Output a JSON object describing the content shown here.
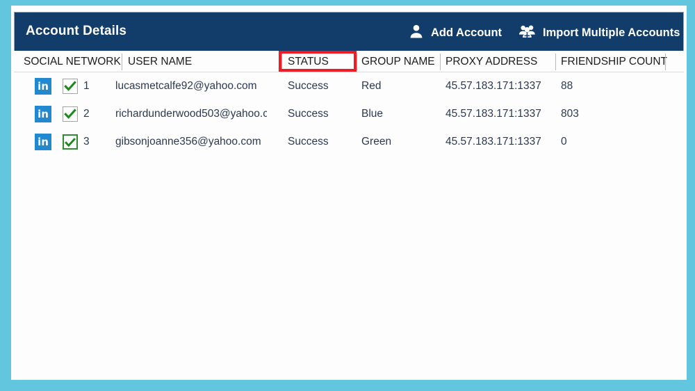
{
  "window": {
    "title": "Account Details",
    "frame_color": "#63c6df",
    "titlebar_color": "#123d6b",
    "body_color": "#fdfdfd"
  },
  "toolbar": {
    "actions": [
      {
        "label": "Add Account",
        "icon": "person-icon"
      },
      {
        "label": "Import Multiple Accounts",
        "icon": "people-group-icon"
      }
    ]
  },
  "table": {
    "columns": [
      {
        "key": "social_network",
        "label": "SOCIAL NETWORK"
      },
      {
        "key": "user_name",
        "label": "USER NAME"
      },
      {
        "key": "status",
        "label": "STATUS"
      },
      {
        "key": "group_name",
        "label": "GROUP NAME"
      },
      {
        "key": "proxy_address",
        "label": "PROXY ADDRESS"
      },
      {
        "key": "friendship_count",
        "label": "FRIENDSHIP COUNT"
      }
    ],
    "highlighted_column": "STATUS",
    "highlight_color": "#ee1c25",
    "rows": [
      {
        "network_icon": "linkedin-icon",
        "network_icon_label": "in",
        "checked": true,
        "checkbox_focused": false,
        "index": "1",
        "user_name": "lucasmetcalfe92@yahoo.com",
        "status": "Success",
        "group_name": "Red",
        "proxy_address": "45.57.183.171:1337",
        "friendship_count": "88"
      },
      {
        "network_icon": "linkedin-icon",
        "network_icon_label": "in",
        "checked": true,
        "checkbox_focused": false,
        "index": "2",
        "user_name": "richardunderwood503@yahoo.c",
        "status": "Success",
        "group_name": "Blue",
        "proxy_address": "45.57.183.171:1337",
        "friendship_count": "803"
      },
      {
        "network_icon": "linkedin-icon",
        "network_icon_label": "in",
        "checked": true,
        "checkbox_focused": true,
        "index": "3",
        "user_name": "gibsonjoanne356@yahoo.com",
        "status": "Success",
        "group_name": "Green",
        "proxy_address": "45.57.183.171:1337",
        "friendship_count": "0"
      }
    ]
  }
}
